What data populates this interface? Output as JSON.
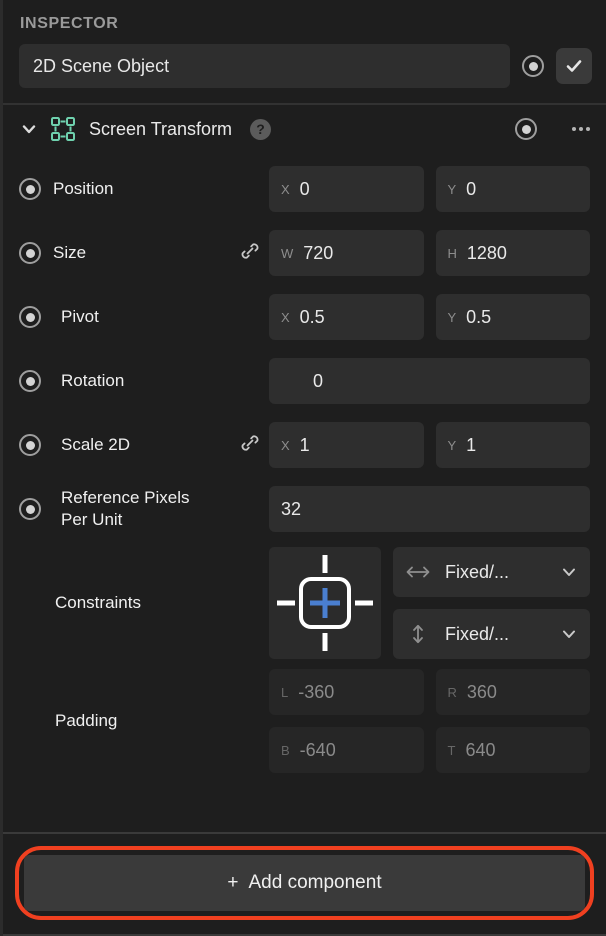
{
  "header": {
    "title": "INSPECTOR"
  },
  "object": {
    "name": "2D Scene Object",
    "record_icon": "record-dot-icon",
    "enabled_icon": "checkmark-icon"
  },
  "component": {
    "expand_icon": "chevron-down-icon",
    "type_icon": "screen-transform-icon",
    "type_icon_color": "#6fd1ae",
    "name": "Screen Transform",
    "help_icon": "question-mark-icon",
    "record_icon": "record-dot-icon",
    "more_icon": "more-options-icon"
  },
  "properties": [
    {
      "label": "Position",
      "keyframe_icon": "keyframe-dot-icon",
      "link": false,
      "fields": [
        {
          "axis": "X",
          "value": "0",
          "disabled": false
        },
        {
          "axis": "Y",
          "value": "0",
          "disabled": false
        }
      ]
    },
    {
      "label": "Size",
      "keyframe_icon": "keyframe-dot-icon",
      "link": true,
      "link_icon": "link-chain-icon",
      "fields": [
        {
          "axis": "W",
          "value": "720",
          "disabled": false
        },
        {
          "axis": "H",
          "value": "1280",
          "disabled": false
        }
      ]
    },
    {
      "label": "Pivot",
      "keyframe_icon": "keyframe-dot-icon",
      "link": false,
      "fields": [
        {
          "axis": "X",
          "value": "0.5",
          "disabled": false
        },
        {
          "axis": "Y",
          "value": "0.5",
          "disabled": false
        }
      ]
    },
    {
      "label": "Rotation",
      "keyframe_icon": "keyframe-dot-icon",
      "link": false,
      "single": true,
      "fields": [
        {
          "axis": "",
          "value": "0",
          "disabled": false
        }
      ]
    },
    {
      "label": "Scale 2D",
      "keyframe_icon": "keyframe-dot-icon",
      "link": true,
      "link_icon": "link-chain-icon",
      "fields": [
        {
          "axis": "X",
          "value": "1",
          "disabled": false
        },
        {
          "axis": "Y",
          "value": "1",
          "disabled": false
        }
      ]
    },
    {
      "label": "Reference Pixels Per Unit",
      "keyframe_icon": "keyframe-dot-icon",
      "link": false,
      "single": true,
      "fields": [
        {
          "axis": "",
          "value": "32",
          "disabled": false
        }
      ]
    }
  ],
  "constraints": {
    "label": "Constraints",
    "widget_icon": "constraints-anchor-icon",
    "plus_color": "#4a7fd0",
    "horizontal": {
      "icon": "horizontal-arrows-icon",
      "value": "Fixed/...",
      "chevron_icon": "chevron-down-icon"
    },
    "vertical": {
      "icon": "vertical-arrows-icon",
      "value": "Fixed/...",
      "chevron_icon": "chevron-down-icon"
    }
  },
  "padding": {
    "label": "Padding",
    "fields": [
      {
        "axis": "L",
        "value": "-360"
      },
      {
        "axis": "R",
        "value": "360"
      },
      {
        "axis": "B",
        "value": "-640"
      },
      {
        "axis": "T",
        "value": "640"
      }
    ]
  },
  "footer": {
    "add_component_label": "Add component",
    "add_plus": "+",
    "highlight_color": "#f04020"
  }
}
